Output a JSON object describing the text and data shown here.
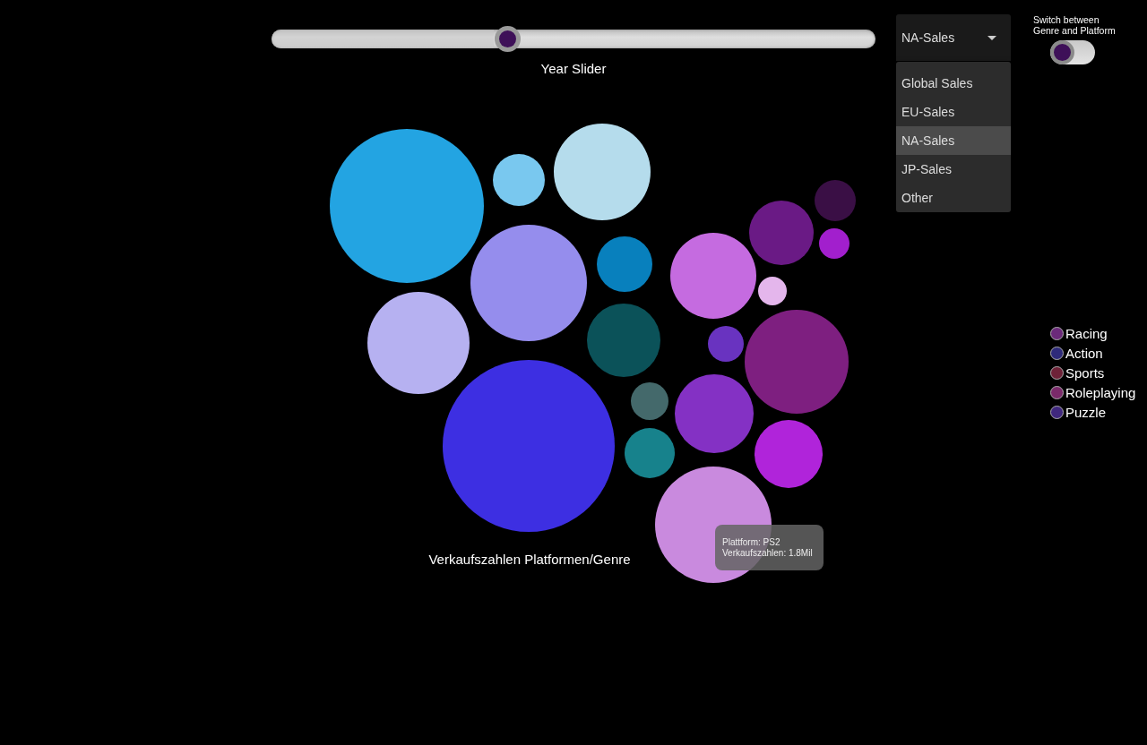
{
  "year_slider": {
    "label": "Year Slider",
    "level": 0.39
  },
  "metric_dropdown": {
    "value": "NA-Sales",
    "expanded": true,
    "options": [
      {
        "label": "Global Sales",
        "selected": false
      },
      {
        "label": "EU-Sales",
        "selected": false
      },
      {
        "label": "NA-Sales",
        "selected": true
      },
      {
        "label": "JP-Sales",
        "selected": false
      },
      {
        "label": "Other",
        "selected": false
      }
    ]
  },
  "view_switch": {
    "label": "Switch between\nGenre and Platform",
    "on": false
  },
  "bubble_chart": {
    "kind": "picture",
    "caption": "Verkaufszahlen Platformen/Genre"
  },
  "tooltip": {
    "lines": [
      "Plattform: PS2",
      "Verkaufszahlen: 1.8Mil"
    ]
  },
  "legend": [
    {
      "label": "Racing",
      "color": "#6b2a7a"
    },
    {
      "label": "Action",
      "color": "#2e2a7a"
    },
    {
      "label": "Sports",
      "color": "#6e2238"
    },
    {
      "label": "Roleplaying",
      "color": "#7a2a6a"
    },
    {
      "label": "Puzzle",
      "color": "#40287e"
    }
  ]
}
